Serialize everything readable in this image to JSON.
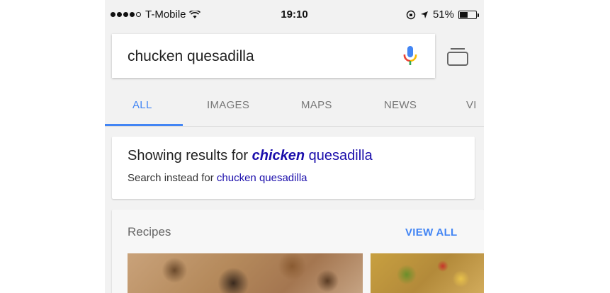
{
  "status_bar": {
    "carrier": "T-Mobile",
    "time": "19:10",
    "battery": "51%"
  },
  "search": {
    "query": "chucken quesadilla"
  },
  "tabs": [
    {
      "label": "ALL",
      "active": true
    },
    {
      "label": "IMAGES"
    },
    {
      "label": "MAPS"
    },
    {
      "label": "NEWS"
    },
    {
      "label": "VI"
    }
  ],
  "correction": {
    "prefix": "Showing results for ",
    "corrected_word": "chicken",
    "corrected_rest": " quesadilla",
    "instead_prefix": "Search instead for ",
    "instead_link": "chucken quesadilla"
  },
  "recipes": {
    "heading": "Recipes",
    "view_all": "VIEW ALL"
  },
  "colors": {
    "accent": "#4285f4",
    "link": "#1a0dab"
  }
}
